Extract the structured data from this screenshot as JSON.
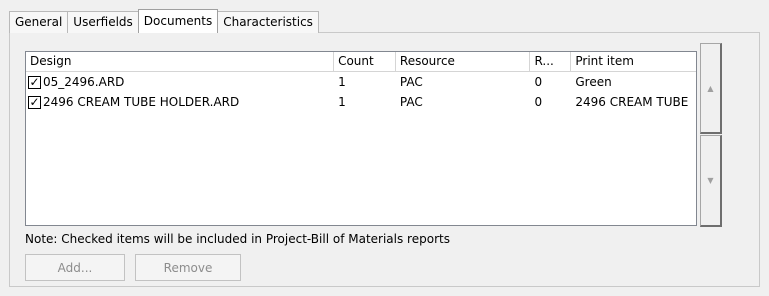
{
  "tabs": [
    {
      "label": "General"
    },
    {
      "label": "Userfields"
    },
    {
      "label": "Documents"
    },
    {
      "label": "Characteristics"
    }
  ],
  "list": {
    "columns": [
      "Design",
      "Count",
      "Resource",
      "R...",
      "Print item"
    ],
    "rows": [
      {
        "checked": true,
        "design": "05_2496.ARD",
        "count": "1",
        "resource": "PAC",
        "r": "0",
        "print_item": "Green"
      },
      {
        "checked": true,
        "design": "2496 CREAM TUBE HOLDER.ARD",
        "count": "1",
        "resource": "PAC",
        "r": "0",
        "print_item": "2496 CREAM TUBE"
      }
    ]
  },
  "scroll": {
    "up_icon": "scroll-up-arrow",
    "down_icon": "scroll-down-arrow"
  },
  "note": "Note: Checked items will be included in Project-Bill of Materials reports",
  "buttons": {
    "add": "Add...",
    "remove": "Remove"
  }
}
